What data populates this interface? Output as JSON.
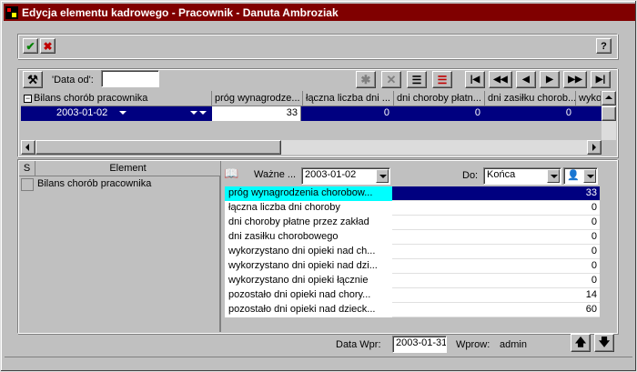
{
  "window": {
    "title": "Edycja elementu kadrowego - Pracownik - Danuta Ambroziak"
  },
  "toolbar": {
    "ok_icon": "check-icon",
    "cancel_icon": "x-icon",
    "help_label": "?"
  },
  "filter": {
    "data_od_label": "'Data od':",
    "data_od_value": ""
  },
  "nav": {
    "first": "|◀",
    "prev_page": "◀◀",
    "prev": "◀",
    "next": "▶",
    "next_page": "▶▶",
    "last": "▶|"
  },
  "grid": {
    "columns": [
      "Bilans chorób pracownika",
      "próg wynagrodze...",
      "łączna liczba dni ...",
      "dni choroby płatn...",
      "dni zasiłku chorob...",
      "wyko"
    ],
    "row": {
      "date": "2003-01-02",
      "v1": "33",
      "v2": "0",
      "v3": "0",
      "v4": "0"
    }
  },
  "element_list": {
    "col_s": "S",
    "col_element": "Element",
    "items": [
      "Bilans chorób pracownika"
    ]
  },
  "props_header": {
    "wazne_label": "Ważne ...",
    "wazne_value": "2003-01-02",
    "do_label": "Do:",
    "do_value": "Końca"
  },
  "properties": [
    {
      "label": "próg wynagrodzenia chorobow...",
      "value": "33"
    },
    {
      "label": "łączna liczba dni choroby",
      "value": "0"
    },
    {
      "label": "dni choroby płatne przez zakład",
      "value": "0"
    },
    {
      "label": "dni zasiłku chorobowego",
      "value": "0"
    },
    {
      "label": "wykorzystano dni opieki nad ch...",
      "value": "0"
    },
    {
      "label": "wykorzystano dni opieki nad dzi...",
      "value": "0"
    },
    {
      "label": "wykorzystano dni opieki łącznie",
      "value": "0"
    },
    {
      "label": "pozostało dni opieki nad chory...",
      "value": "14"
    },
    {
      "label": "pozostało dni opieki nad dzieck...",
      "value": "60"
    }
  ],
  "status": {
    "data_wpr_label": "Data Wpr:",
    "data_wpr_value": "2003-01-31",
    "wprow_label": "Wprow:",
    "wprow_value": "admin"
  },
  "colors": {
    "title_bg": "#800000",
    "selection": "#000080",
    "highlight_label": "#00ffff"
  }
}
